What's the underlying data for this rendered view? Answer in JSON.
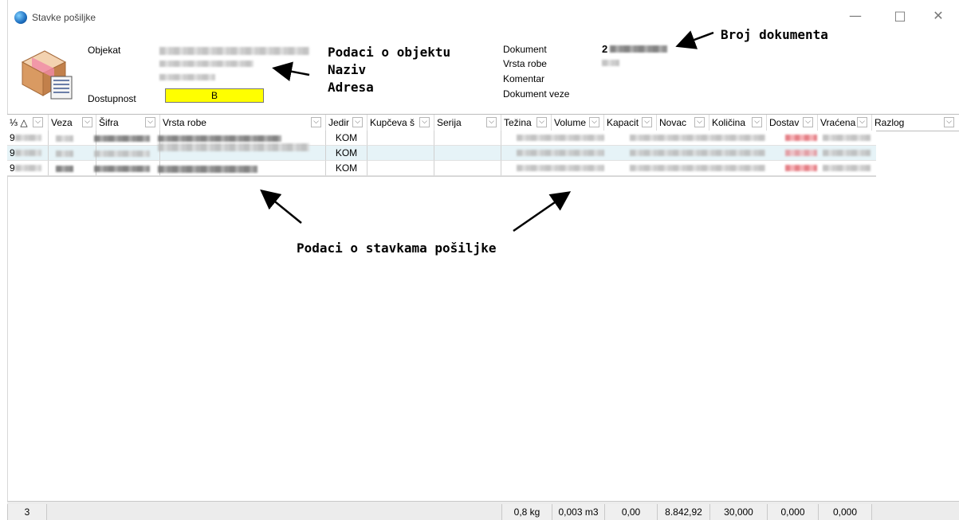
{
  "window": {
    "title": "Stavke pošiljke",
    "minimize": "—",
    "maximize": "□",
    "close": "✕"
  },
  "header": {
    "object_label": "Objekat",
    "availability_label": "Dostupnost",
    "availability_value": "B",
    "availability_color": "#ffff00",
    "document_label": "Dokument",
    "document_value_prefix": "2",
    "goods_type_label": "Vrsta robe",
    "comment_label": "Komentar",
    "related_doc_label": "Dokument veze"
  },
  "annotations": {
    "object_data": "Podaci o objektu",
    "name": "Naziv",
    "address": "Adresa",
    "doc_number": "Broj dokumenta",
    "items_data": "Podaci o stavkama pošiljke"
  },
  "grid": {
    "columns": [
      "⅓ △",
      "Veza",
      "Šifra",
      "Vrsta robe",
      "Jedir",
      "Kupčeva š",
      "Serija",
      "Težina",
      "Volume",
      "Kapacit",
      "Novac",
      "Količina",
      "Dostav",
      "Vraćena",
      "Razlog"
    ],
    "rows": [
      {
        "id_prefix": "9",
        "unit": "KOM"
      },
      {
        "id_prefix": "9",
        "unit": "KOM"
      },
      {
        "id_prefix": "9",
        "unit": "KOM"
      }
    ]
  },
  "footer": {
    "count": "3",
    "weight": "0,8 kg",
    "volume": "0,003 m3",
    "capacity": "0,00",
    "money": "8.842,92",
    "quantity": "30,000",
    "delivered": "0,000",
    "returned": "0,000"
  }
}
